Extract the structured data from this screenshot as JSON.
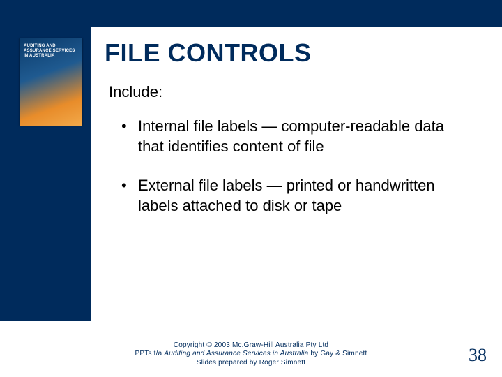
{
  "cover": {
    "label": "AUDITING AND ASSURANCE SERVICES IN AUSTRALIA"
  },
  "title": "FILE CONTROLS",
  "intro": "Include:",
  "bullets": [
    "Internal file labels — computer-readable data that identifies content of file",
    "External file labels — printed or handwritten labels attached to disk or tape"
  ],
  "footer": {
    "line1_prefix": "Copyright ",
    "line1_symbol": "©",
    "line1_suffix": " 2003 Mc.Graw-Hill Australia Pty Ltd",
    "line2_prefix": "PPTs t/a ",
    "line2_title": "Auditing and Assurance Services in Australia",
    "line2_suffix": " by Gay & Simnett",
    "line3": "Slides prepared by Roger Simnett"
  },
  "pagenum": "38"
}
